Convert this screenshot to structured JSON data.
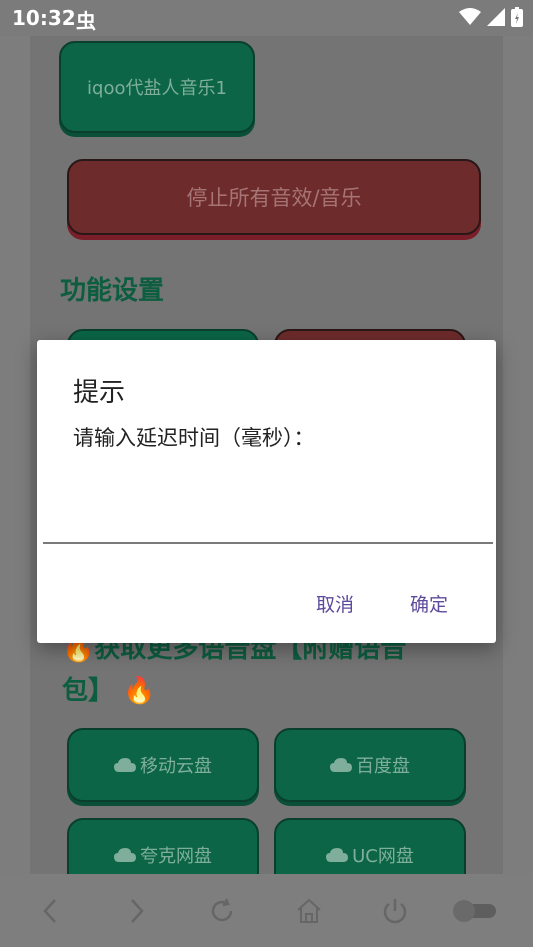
{
  "status": {
    "time": "10:32",
    "notif_glyph": "虫"
  },
  "buttons": {
    "iqoo": "iqoo代盐人音乐1",
    "stop_all": "停止所有音效/音乐"
  },
  "section_func": "功能设置",
  "section_more": {
    "line1": "获取更多语音盘【附赠语音",
    "line2": "包】"
  },
  "cloud_buttons": [
    "移动云盘",
    "百度盘",
    "夸克网盘",
    "UC网盘"
  ],
  "dialog": {
    "title": "提示",
    "message": "请输入延迟时间（毫秒）：",
    "input_value": "",
    "cancel": "取消",
    "confirm": "确定"
  },
  "colors": {
    "accent": "#5d4a9d",
    "green": "#0b6546",
    "red": "#6e2b2b"
  }
}
